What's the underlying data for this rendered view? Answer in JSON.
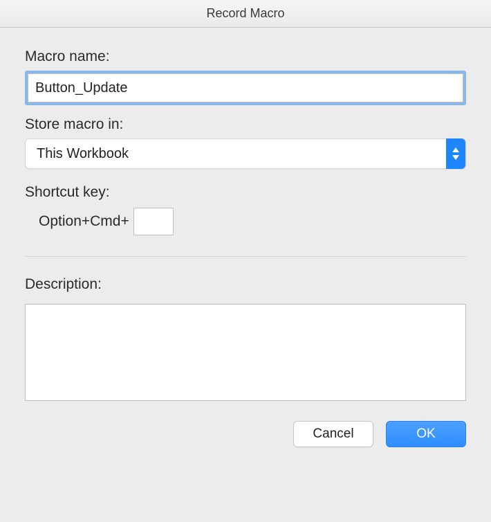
{
  "dialog": {
    "title": "Record Macro",
    "macroName": {
      "label": "Macro name:",
      "value": "Button_Update"
    },
    "storeIn": {
      "label": "Store macro in:",
      "value": "This Workbook"
    },
    "shortcut": {
      "label": "Shortcut key:",
      "prefix": "Option+Cmd+",
      "value": ""
    },
    "description": {
      "label": "Description:",
      "value": ""
    },
    "buttons": {
      "cancel": "Cancel",
      "ok": "OK"
    }
  }
}
